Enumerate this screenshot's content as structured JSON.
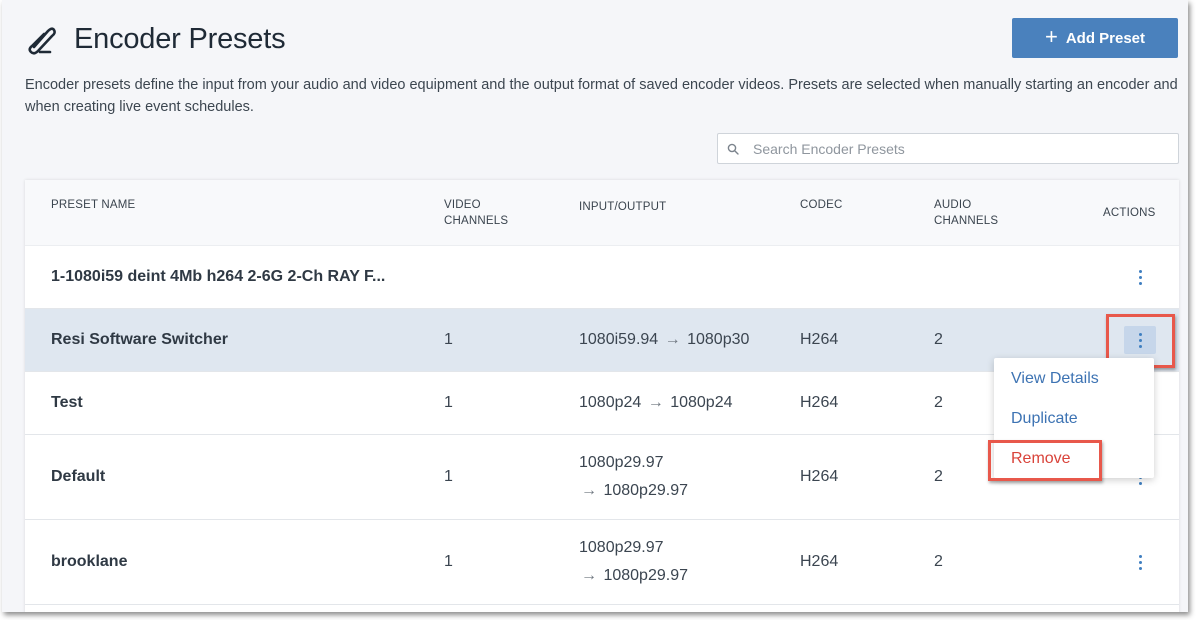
{
  "page": {
    "title": "Encoder Presets",
    "add_button_label": "Add Preset",
    "description": "Encoder presets define the input from your audio and video equipment and the output format of saved encoder videos. Presets are selected when manually starting an encoder and when creating live event schedules."
  },
  "search": {
    "placeholder": "Search Encoder Presets"
  },
  "table": {
    "columns": {
      "name": "PRESET NAME",
      "video_channels_1": "VIDEO",
      "video_channels_2": "CHANNELS",
      "io": "INPUT/OUTPUT",
      "codec": "CODEC",
      "audio_channels_1": "AUDIO",
      "audio_channels_2": "CHANNELS",
      "actions": "ACTIONS"
    },
    "rows": [
      {
        "name": "1-1080i59 deint 4Mb h264 2-6G 2-Ch RAY F...",
        "video": "",
        "input": "",
        "output": "",
        "codec": "",
        "audio": ""
      },
      {
        "name": "Resi Software Switcher",
        "video": "1",
        "input": "1080i59.94",
        "output": "1080p30",
        "codec": "H264",
        "audio": "2"
      },
      {
        "name": "Test",
        "video": "1",
        "input": "1080p24",
        "output": "1080p24",
        "codec": "H264",
        "audio": "2"
      },
      {
        "name": "Default",
        "video": "1",
        "input": "1080p29.97",
        "output": "1080p29.97",
        "codec": "H264",
        "audio": "2"
      },
      {
        "name": "brooklane",
        "video": "1",
        "input": "1080p29.97",
        "output": "1080p29.97",
        "codec": "H264",
        "audio": "2"
      }
    ],
    "arrow": "→"
  },
  "actions_menu": {
    "items": [
      "View Details",
      "Duplicate",
      "Remove"
    ]
  },
  "colors": {
    "accent": "#4a81bd",
    "highlight": "#e8584b",
    "link": "#3d73b3",
    "danger": "#d9433a",
    "selected_row": "#dfe7f0"
  },
  "icons": {
    "logo": "pen-scribble-icon",
    "add": "plus-icon",
    "search": "search-icon",
    "row_actions": "kebab-menu-icon",
    "io_arrow": "arrow-right-icon"
  }
}
